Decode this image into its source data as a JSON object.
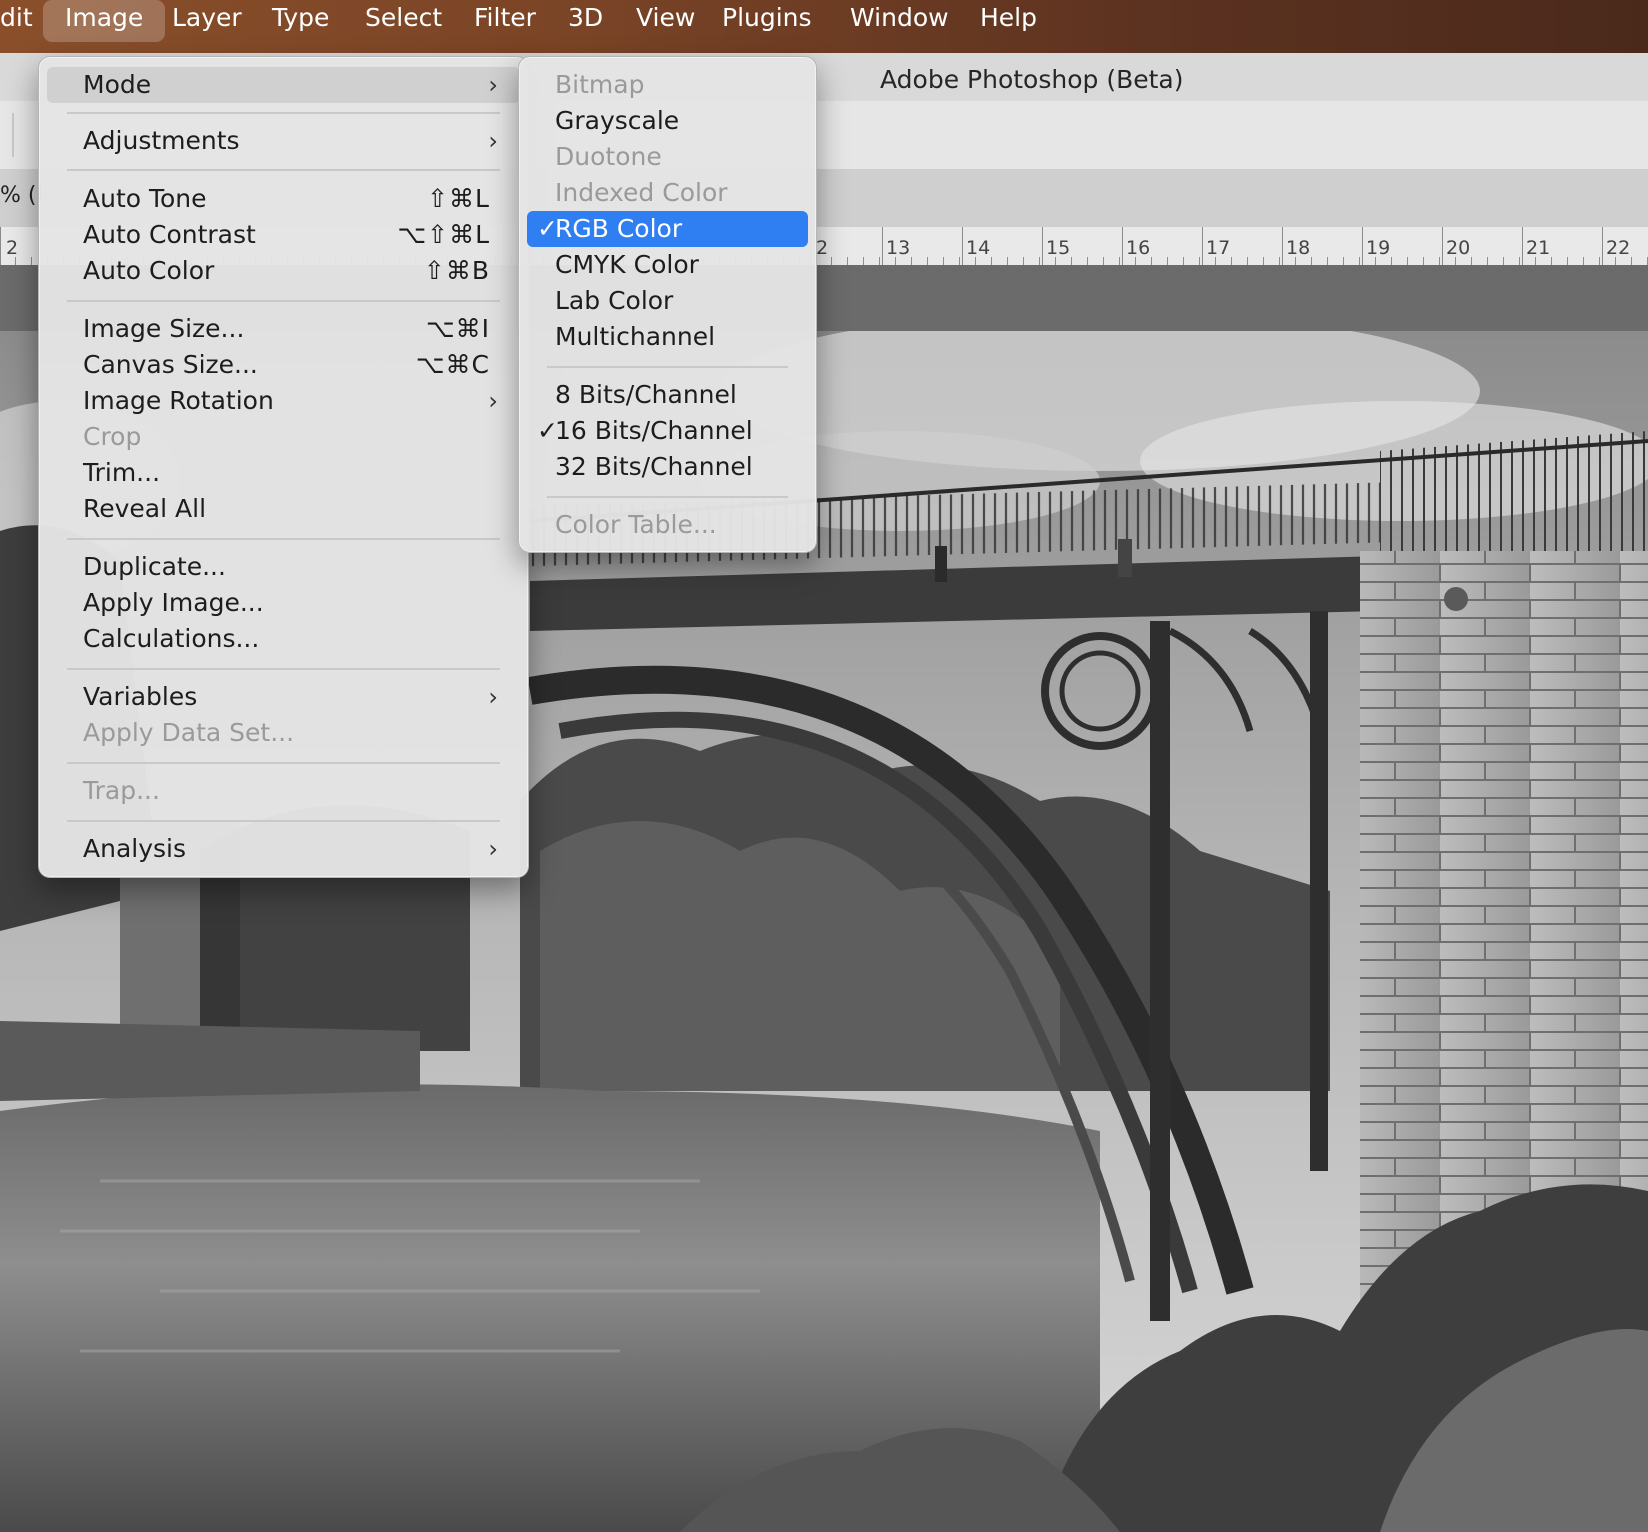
{
  "menubar": {
    "items": [
      "dit",
      "Image",
      "Layer",
      "Type",
      "Select",
      "Filter",
      "3D",
      "View",
      "Plugins",
      "Window",
      "Help"
    ],
    "active": "Image"
  },
  "window": {
    "title": "Adobe Photoshop (Beta)",
    "doc_tab_fragment": "% (I",
    "ruler_labels": [
      "2",
      "2",
      "13",
      "14",
      "15",
      "16",
      "17",
      "18",
      "19",
      "20",
      "21",
      "22"
    ]
  },
  "image_menu": {
    "items": [
      {
        "label": "Mode",
        "submenu": true,
        "shortcut": "",
        "disabled": false
      },
      {
        "label": "Adjustments",
        "submenu": true,
        "shortcut": "",
        "disabled": false
      },
      {
        "label": "Auto Tone",
        "submenu": false,
        "shortcut": "⇧⌘L",
        "disabled": false
      },
      {
        "label": "Auto Contrast",
        "submenu": false,
        "shortcut": "⌥⇧⌘L",
        "disabled": false
      },
      {
        "label": "Auto Color",
        "submenu": false,
        "shortcut": "⇧⌘B",
        "disabled": false
      },
      {
        "label": "Image Size...",
        "submenu": false,
        "shortcut": "⌥⌘I",
        "disabled": false
      },
      {
        "label": "Canvas Size...",
        "submenu": false,
        "shortcut": "⌥⌘C",
        "disabled": false
      },
      {
        "label": "Image Rotation",
        "submenu": true,
        "shortcut": "",
        "disabled": false
      },
      {
        "label": "Crop",
        "submenu": false,
        "shortcut": "",
        "disabled": true
      },
      {
        "label": "Trim...",
        "submenu": false,
        "shortcut": "",
        "disabled": false
      },
      {
        "label": "Reveal All",
        "submenu": false,
        "shortcut": "",
        "disabled": false
      },
      {
        "label": "Duplicate...",
        "submenu": false,
        "shortcut": "",
        "disabled": false
      },
      {
        "label": "Apply Image...",
        "submenu": false,
        "shortcut": "",
        "disabled": false
      },
      {
        "label": "Calculations...",
        "submenu": false,
        "shortcut": "",
        "disabled": false
      },
      {
        "label": "Variables",
        "submenu": true,
        "shortcut": "",
        "disabled": false
      },
      {
        "label": "Apply Data Set...",
        "submenu": false,
        "shortcut": "",
        "disabled": true
      },
      {
        "label": "Trap...",
        "submenu": false,
        "shortcut": "",
        "disabled": true
      },
      {
        "label": "Analysis",
        "submenu": true,
        "shortcut": "",
        "disabled": false
      }
    ]
  },
  "mode_menu": {
    "items": [
      {
        "label": "Bitmap",
        "checked": false,
        "disabled": true,
        "selected": false
      },
      {
        "label": "Grayscale",
        "checked": false,
        "disabled": false,
        "selected": false
      },
      {
        "label": "Duotone",
        "checked": false,
        "disabled": true,
        "selected": false
      },
      {
        "label": "Indexed Color",
        "checked": false,
        "disabled": true,
        "selected": false
      },
      {
        "label": "RGB Color",
        "checked": true,
        "disabled": false,
        "selected": true
      },
      {
        "label": "CMYK Color",
        "checked": false,
        "disabled": false,
        "selected": false
      },
      {
        "label": "Lab Color",
        "checked": false,
        "disabled": false,
        "selected": false
      },
      {
        "label": "Multichannel",
        "checked": false,
        "disabled": false,
        "selected": false
      },
      {
        "label": "8 Bits/Channel",
        "checked": false,
        "disabled": false,
        "selected": false
      },
      {
        "label": "16 Bits/Channel",
        "checked": true,
        "disabled": false,
        "selected": false
      },
      {
        "label": "32 Bits/Channel",
        "checked": false,
        "disabled": false,
        "selected": false
      },
      {
        "label": "Color Table...",
        "checked": false,
        "disabled": true,
        "selected": false
      }
    ]
  },
  "icons": {
    "submenu_arrow": "chevron-right-icon",
    "check": "checkmark-icon"
  },
  "colors": {
    "selection": "#2f7ff3",
    "menubar": "#7a4426"
  }
}
